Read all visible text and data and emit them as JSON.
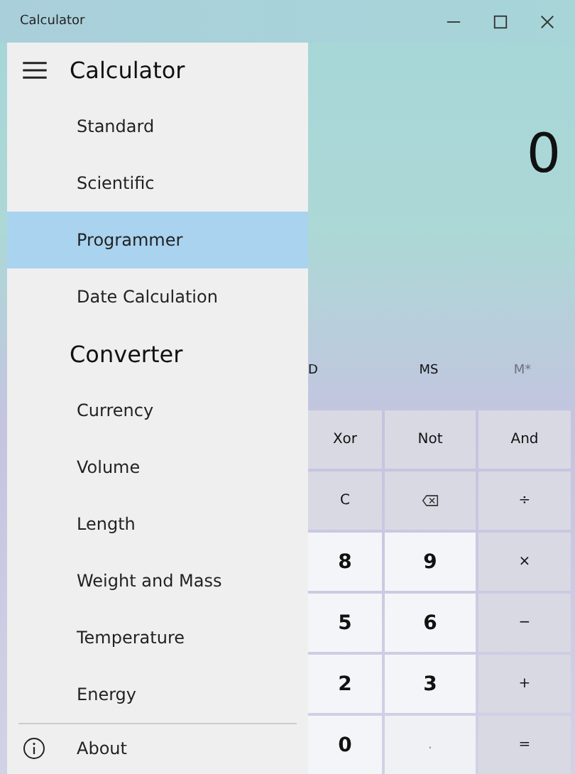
{
  "window": {
    "title": "Calculator"
  },
  "nav": {
    "title": "Calculator",
    "sections": [
      {
        "kind": "item",
        "label": "Standard",
        "selected": false
      },
      {
        "kind": "item",
        "label": "Scientific",
        "selected": false
      },
      {
        "kind": "item",
        "label": "Programmer",
        "selected": true
      },
      {
        "kind": "item",
        "label": "Date Calculation",
        "selected": false
      },
      {
        "kind": "header",
        "label": "Converter"
      },
      {
        "kind": "item",
        "label": "Currency",
        "selected": false
      },
      {
        "kind": "item",
        "label": "Volume",
        "selected": false
      },
      {
        "kind": "item",
        "label": "Length",
        "selected": false
      },
      {
        "kind": "item",
        "label": "Weight and Mass",
        "selected": false
      },
      {
        "kind": "item",
        "label": "Temperature",
        "selected": false
      },
      {
        "kind": "item",
        "label": "Energy",
        "selected": false
      }
    ],
    "about": "About"
  },
  "display": "0",
  "memory": [
    {
      "label": "D",
      "disabled": false
    },
    {
      "label": "MS",
      "disabled": false
    },
    {
      "label": "M*",
      "disabled": true
    }
  ],
  "keys": [
    {
      "kind": "op",
      "label": "Xor"
    },
    {
      "kind": "op",
      "label": "Not"
    },
    {
      "kind": "op",
      "label": "And"
    },
    {
      "kind": "op",
      "label": "C"
    },
    {
      "kind": "backspace"
    },
    {
      "kind": "op",
      "label": "÷"
    },
    {
      "kind": "digit",
      "label": "8"
    },
    {
      "kind": "digit",
      "label": "9"
    },
    {
      "kind": "op",
      "label": "×"
    },
    {
      "kind": "digit",
      "label": "5"
    },
    {
      "kind": "digit",
      "label": "6"
    },
    {
      "kind": "op",
      "label": "−"
    },
    {
      "kind": "digit",
      "label": "2"
    },
    {
      "kind": "digit",
      "label": "3"
    },
    {
      "kind": "op",
      "label": "+"
    },
    {
      "kind": "digit",
      "label": "0"
    },
    {
      "kind": "dot",
      "label": "."
    },
    {
      "kind": "op",
      "label": "="
    }
  ]
}
